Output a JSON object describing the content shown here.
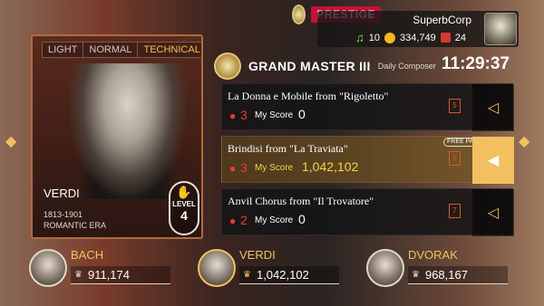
{
  "player": {
    "prestige_label": "PRESTIGE",
    "username": "SuperbCorp",
    "notes": "10",
    "coins": "334,749",
    "gems": "24"
  },
  "composer_card": {
    "difficulty_tabs": [
      "LIGHT",
      "NORMAL",
      "TECHNICAL"
    ],
    "selected_tab": "TECHNICAL",
    "name": "VERDI",
    "years": "1813-1901",
    "era": "ROMANTIC ERA",
    "level_label": "LEVEL",
    "level_value": "4"
  },
  "header": {
    "rank": "GRAND MASTER III",
    "subtitle": "Daily Composer",
    "timer": "11:29:37"
  },
  "songs": [
    {
      "title": "La Donna e Mobile from \"Rigoletto\"",
      "pins": "3",
      "score_label": "My Score",
      "score": "0",
      "number": "5",
      "selected": false
    },
    {
      "title": "Brindisi from \"La Traviata\"",
      "pins": "3",
      "score_label": "My Score",
      "score": "1,042,102",
      "number": "6",
      "selected": true,
      "badge": "FREE PASS"
    },
    {
      "title": "Anvil Chorus from \"Il Trovatore\"",
      "pins": "2",
      "score_label": "My Score",
      "score": "0",
      "number": "7",
      "selected": false
    }
  ],
  "leaderboard": [
    {
      "name": "BACH",
      "score": "911,174"
    },
    {
      "name": "VERDI",
      "score": "1,042,102"
    },
    {
      "name": "DVORAK",
      "score": "968,167"
    }
  ],
  "colors": {
    "accent_gold": "#f2c060",
    "prestige_red": "#c8103a",
    "pin_red": "#e83a3a",
    "score_yellow": "#f4d24a"
  }
}
